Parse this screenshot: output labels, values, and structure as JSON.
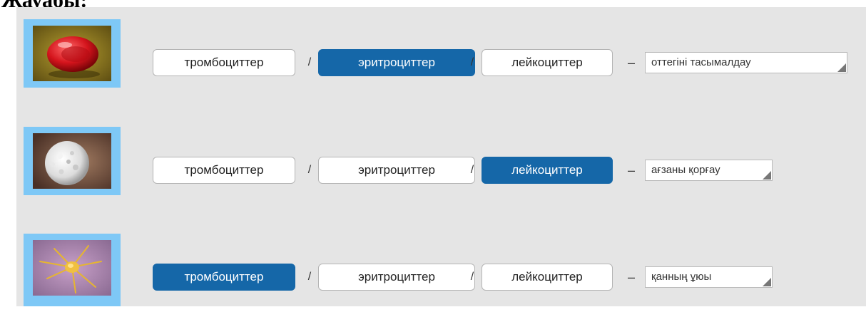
{
  "heading": "Жауабы:",
  "separator": "/",
  "dash": "–",
  "rows": [
    {
      "image_icon": "red-blood-cell-icon",
      "options": [
        "тромбоциттер",
        "эритроциттер",
        "лейкоциттер"
      ],
      "selected": "эритроциттер",
      "answer": "оттегіні тасымалдау"
    },
    {
      "image_icon": "white-blood-cell-icon",
      "options": [
        "тромбоциттер",
        "эритроциттер",
        "лейкоциттер"
      ],
      "selected": "лейкоциттер",
      "answer": "ағзаны қорғау"
    },
    {
      "image_icon": "platelet-icon",
      "options": [
        "тромбоциттер",
        "эритроциттер",
        "лейкоциттер"
      ],
      "selected": "тромбоциттер",
      "answer": "қанның ұюы"
    }
  ],
  "colors": {
    "panel": "#e5e5e5",
    "thumb_frame": "#7ec8f6",
    "selected": "#1567a8"
  }
}
